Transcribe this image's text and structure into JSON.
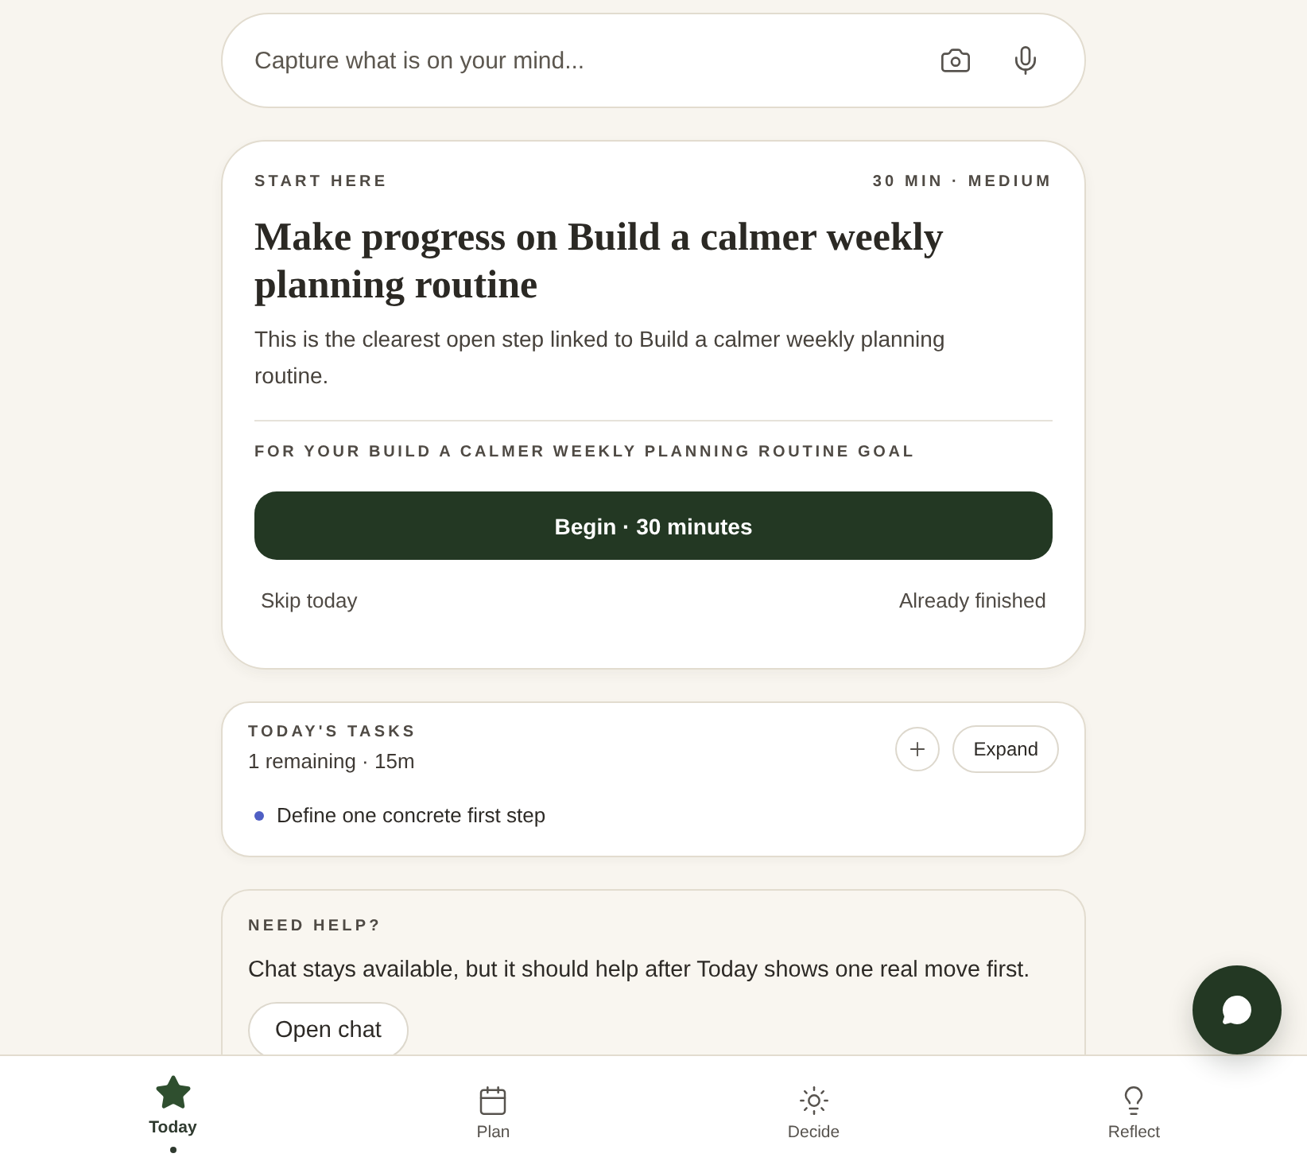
{
  "capture": {
    "placeholder": "Capture what is on your mind..."
  },
  "focus_card": {
    "eyebrow": "START HERE",
    "meta": "30 MIN · MEDIUM",
    "title": "Make progress on Build a calmer weekly planning routine",
    "description": "This is the clearest open step linked to Build a calmer weekly planning routine.",
    "goal_label": "FOR YOUR BUILD A CALMER WEEKLY PLANNING ROUTINE GOAL",
    "primary_button": "Begin · 30 minutes",
    "secondary_actions": [
      "Skip today",
      "Already finished"
    ]
  },
  "tasks_card": {
    "title": "TODAY'S TASKS",
    "summary": "1 remaining · 15m",
    "expand_button": "Expand",
    "tasks": [
      {
        "label": "Define one concrete first step",
        "color": "#4f5fc4"
      }
    ]
  },
  "help_card": {
    "title": "NEED HELP?",
    "text": "Chat stays available, but it should help after Today shows one real move first.",
    "button": "Open chat"
  },
  "bottom_nav": [
    {
      "label": "Today",
      "selected": true
    },
    {
      "label": "Plan",
      "selected": false
    },
    {
      "label": "Decide",
      "selected": false
    },
    {
      "label": "Reflect",
      "selected": false
    }
  ]
}
